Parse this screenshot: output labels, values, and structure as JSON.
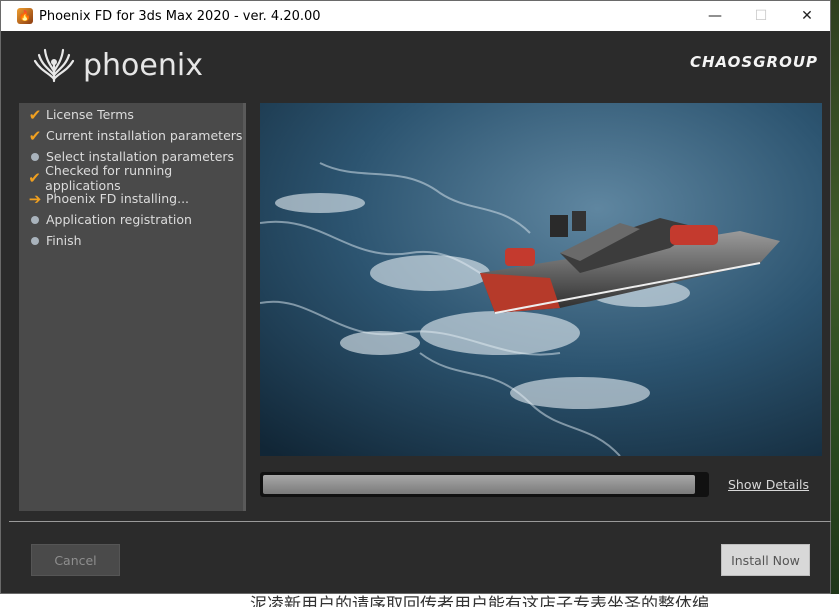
{
  "window": {
    "title": "Phoenix FD for 3ds Max 2020 - ver. 4.20.00",
    "controls": {
      "minimize": "—",
      "maximize": "☐",
      "close": "✕"
    }
  },
  "header": {
    "product_logo": "phoenix",
    "company_logo": "CHAOSGROUP"
  },
  "steps": [
    {
      "label": "License Terms",
      "state": "done",
      "marker": "✔"
    },
    {
      "label": "Current installation parameters",
      "state": "done",
      "marker": "✔"
    },
    {
      "label": "Select installation parameters",
      "state": "pending",
      "marker": ""
    },
    {
      "label": "Checked for running applications",
      "state": "done",
      "marker": "✔"
    },
    {
      "label": "Phoenix FD installing...",
      "state": "current",
      "marker": "➔"
    },
    {
      "label": "Application registration",
      "state": "pending",
      "marker": ""
    },
    {
      "label": "Finish",
      "state": "pending",
      "marker": ""
    }
  ],
  "progress": {
    "value_percent": 98
  },
  "show_details_label": "Show Details",
  "buttons": {
    "cancel": "Cancel",
    "install": "Install Now"
  },
  "colors": {
    "check": "#f0a020",
    "pending_dot": "#a9b3bc",
    "background": "#2b2b2b",
    "panel": "#4a4a4a"
  },
  "background_text": "泥凌新用户的请序取回传者用户能有这店子专表坐圣的整体编"
}
